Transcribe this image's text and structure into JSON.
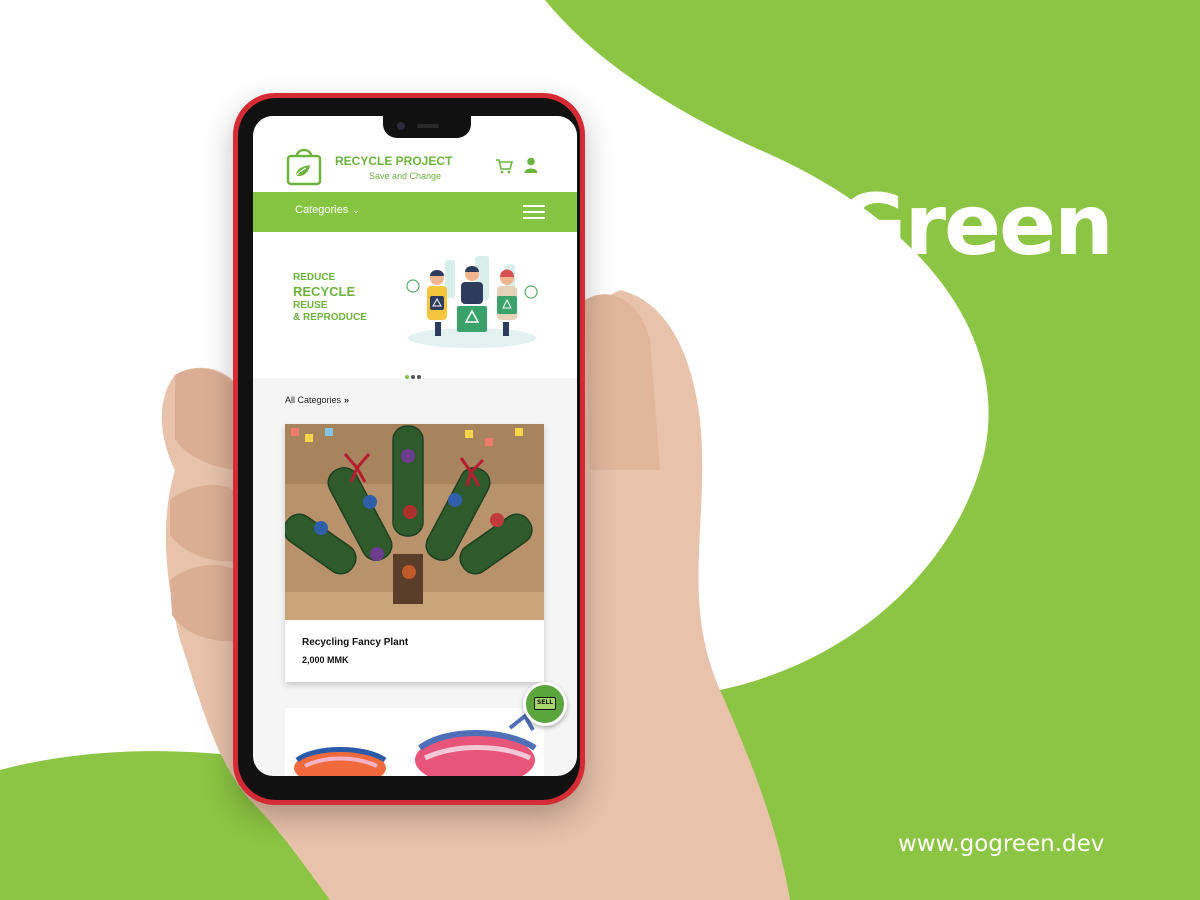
{
  "brand": {
    "logo_text": "GoGreen",
    "website": "www.gogreen.dev",
    "primary_color": "#8bc543",
    "accent_red": "#d52b35"
  },
  "app": {
    "title": "RECYCLE PROJECT",
    "subtitle": "Save and Change",
    "logo_icon": "shopping-bag-leaf-icon",
    "header_icons": [
      "cart-icon",
      "user-icon"
    ]
  },
  "navbar": {
    "categories_label": "Categories",
    "categories_icon": "chevron-down-icon",
    "menu_icon": "hamburger-menu-icon"
  },
  "banner": {
    "line1": "REDUCE",
    "line2": "RECYCLE",
    "line3": "REUSE",
    "line4": "& REPRODUCE",
    "illustration": "recycling-people-illustration",
    "slides": 3,
    "active_slide": 1
  },
  "listing": {
    "all_categories_label": "All Categories",
    "all_categories_icon": "double-chevron-right-icon",
    "products": [
      {
        "name": "Recycling Fancy Plant",
        "price": "2,000 MMK",
        "image": "bottle-plant-photo"
      },
      {
        "name": "",
        "price": "",
        "image": "woven-basket-photo"
      }
    ]
  },
  "sell_button": {
    "label": "SELL",
    "icon": "sell-tag-icon"
  }
}
